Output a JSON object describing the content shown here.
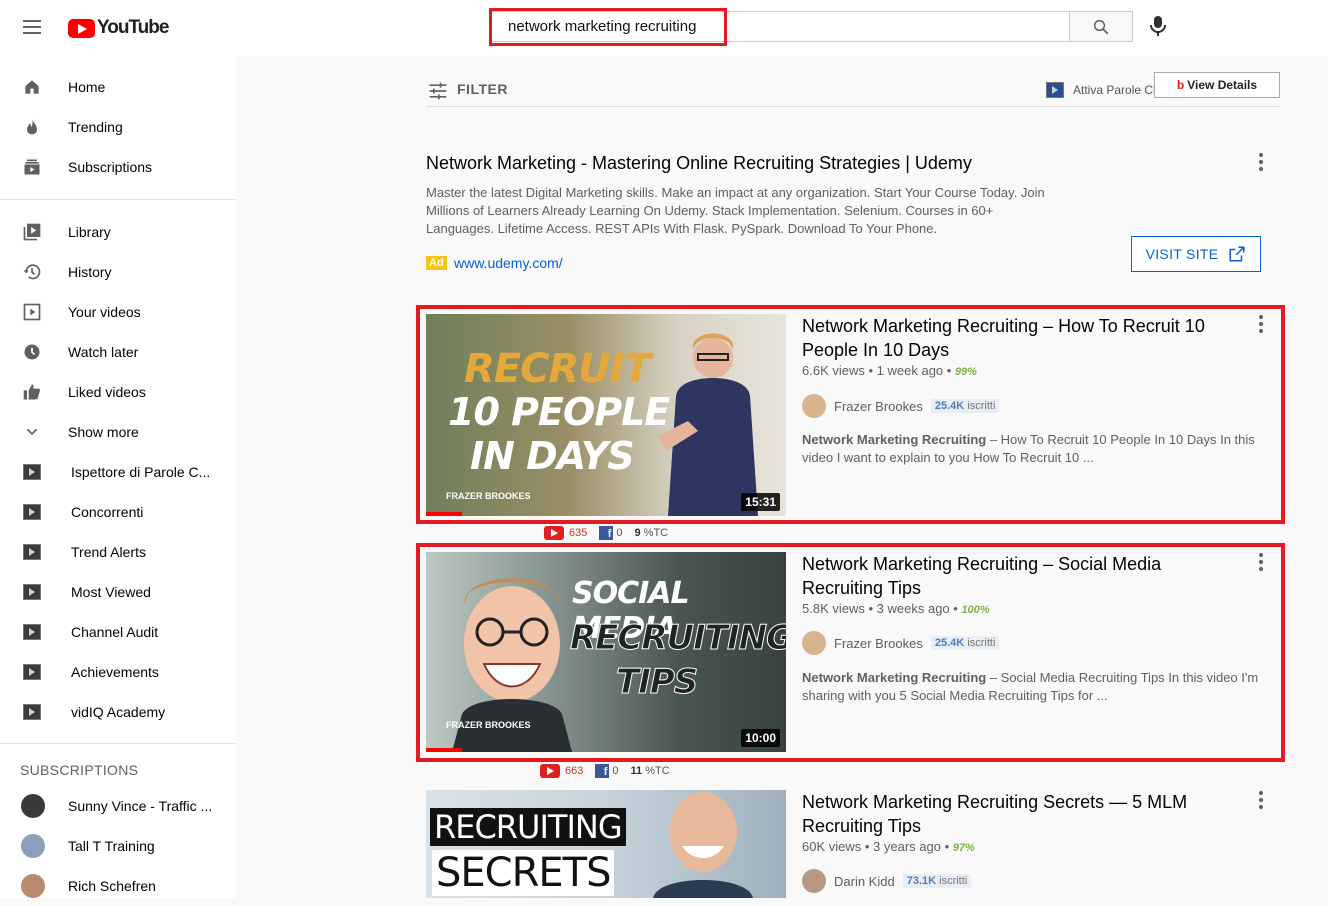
{
  "header": {
    "logo_text": "YouTube",
    "search_value": "network marketing recruiting",
    "icons": [
      "menu-icon",
      "search-icon",
      "mic-icon"
    ]
  },
  "sidebar": {
    "main": [
      {
        "label": "Home",
        "icon": "home-icon"
      },
      {
        "label": "Trending",
        "icon": "trending-icon"
      },
      {
        "label": "Subscriptions",
        "icon": "subscriptions-icon"
      }
    ],
    "library": [
      {
        "label": "Library",
        "icon": "library-icon"
      },
      {
        "label": "History",
        "icon": "history-icon"
      },
      {
        "label": "Your videos",
        "icon": "your-videos-icon"
      },
      {
        "label": "Watch later",
        "icon": "watch-later-icon"
      },
      {
        "label": "Liked videos",
        "icon": "like-icon"
      },
      {
        "label": "Show more",
        "icon": "chevron-down-icon"
      }
    ],
    "extensions": [
      {
        "label": "Ispettore di Parole C..."
      },
      {
        "label": "Concorrenti"
      },
      {
        "label": "Trend Alerts"
      },
      {
        "label": "Most Viewed"
      },
      {
        "label": "Channel Audit"
      },
      {
        "label": "Achievements"
      },
      {
        "label": "vidIQ Academy"
      }
    ],
    "subscriptions_title": "SUBSCRIPTIONS",
    "subscriptions": [
      {
        "label": "Sunny Vince - Traffic ...",
        "color": "#3a3a3a"
      },
      {
        "label": "Tall T Training",
        "color": "#8aa0b8"
      },
      {
        "label": "Rich Schefren",
        "color": "#b98c6e"
      }
    ]
  },
  "toolbar": {
    "filter_label": "FILTER",
    "attiva_label": "Attiva Parole Chiave Incorporate",
    "view_details_label": "View Details"
  },
  "ad": {
    "title": "Network Marketing - Mastering Online Recruiting Strategies | Udemy",
    "description": "Master the latest Digital Marketing skills. Make an impact at any organization. Start Your Course Today. Join Millions of Learners Already Learning On Udemy. Stack Implementation. Selenium. Courses in 60+ Languages. Lifetime Access. REST APIs With Flask. PySpark. Download To Your Phone.",
    "badge": "Ad",
    "url": "www.udemy.com/",
    "visit_label": "VISIT SITE"
  },
  "videos": [
    {
      "title": "Network Marketing Recruiting – How To Recruit 10 People In 10 Days",
      "views": "6.6K views",
      "age": "1 week ago",
      "score": "99%",
      "channel": "Frazer Brookes",
      "subs_count": "25.4K",
      "subs_word": "iscritti",
      "desc_bold": "Network Marketing Recruiting",
      "desc_rest": " – How To Recruit 10 People In 10 Days In this video I want to explain to you How To Recruit 10 ...",
      "duration": "15:31",
      "thumb_line1": "RECRUIT",
      "thumb_line2": "10 PEOPLE",
      "thumb_line3": "IN DAYS",
      "thumb_brand": "FRAZER BROOKES",
      "stat_yt": "635",
      "stat_fb": "0",
      "stat_tc": "9",
      "stat_tc_unit": "%TC",
      "watched": 0.1
    },
    {
      "title": "Network Marketing Recruiting – Social Media Recruiting Tips",
      "views": "5.8K views",
      "age": "3 weeks ago",
      "score": "100%",
      "channel": "Frazer Brookes",
      "subs_count": "25.4K",
      "subs_word": "iscritti",
      "desc_bold": "Network Marketing Recruiting",
      "desc_rest": " – Social Media Recruiting Tips In this video I'm sharing with you 5 Social Media Recruiting Tips for ...",
      "duration": "10:00",
      "thumb_line1": "SOCIAL MEDIA",
      "thumb_line2": "RECRUITING",
      "thumb_line3": "TIPS",
      "thumb_brand": "FRAZER BROOKES",
      "stat_yt": "663",
      "stat_fb": "0",
      "stat_tc": "11",
      "stat_tc_unit": "%TC",
      "watched": 0.1
    },
    {
      "title": "Network Marketing Recruiting Secrets — 5 MLM Recruiting Tips",
      "views": "60K views",
      "age": "3 years ago",
      "score": "97%",
      "channel": "Darin Kidd",
      "subs_count": "73.1K",
      "subs_word": "iscritti",
      "thumb_line1": "RECRUITING",
      "thumb_line2": "SECRETS"
    }
  ],
  "colors": {
    "highlight": "#e51b23",
    "brand": "#ff0000",
    "link": "#065fd4",
    "score": "#7cb342"
  }
}
